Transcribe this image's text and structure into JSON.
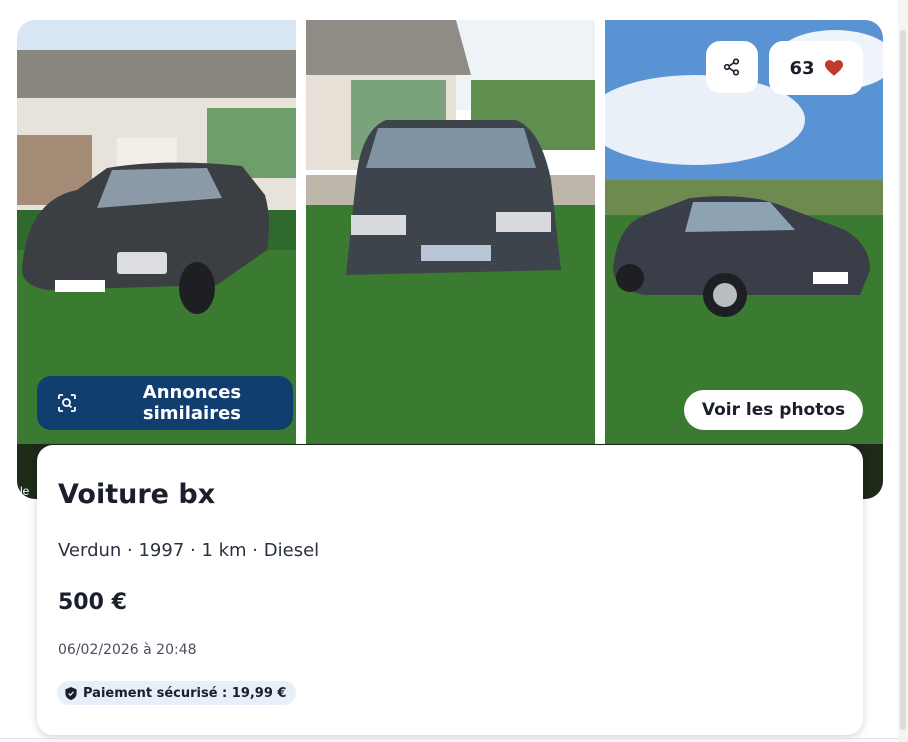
{
  "gallery": {
    "similar_button": "Annonces similaires",
    "favorites_count": "63",
    "see_photos_button": "Voir les photos",
    "watermark": "le"
  },
  "listing": {
    "title": "Voiture bx",
    "meta": "Verdun · 1997 · 1 km · Diesel",
    "price": "500 €",
    "date": "06/02/2026 à 20:48",
    "payment_badge": "Paiement sécurisé : 19,99 €"
  },
  "icons": {
    "share": "share-icon",
    "favorite": "heart-icon",
    "similar": "image-search-icon",
    "badge": "shield-icon"
  },
  "colors": {
    "accent_blue": "#103f6f",
    "heart_red": "#c0392b",
    "badge_bg": "#e6f0fb"
  }
}
